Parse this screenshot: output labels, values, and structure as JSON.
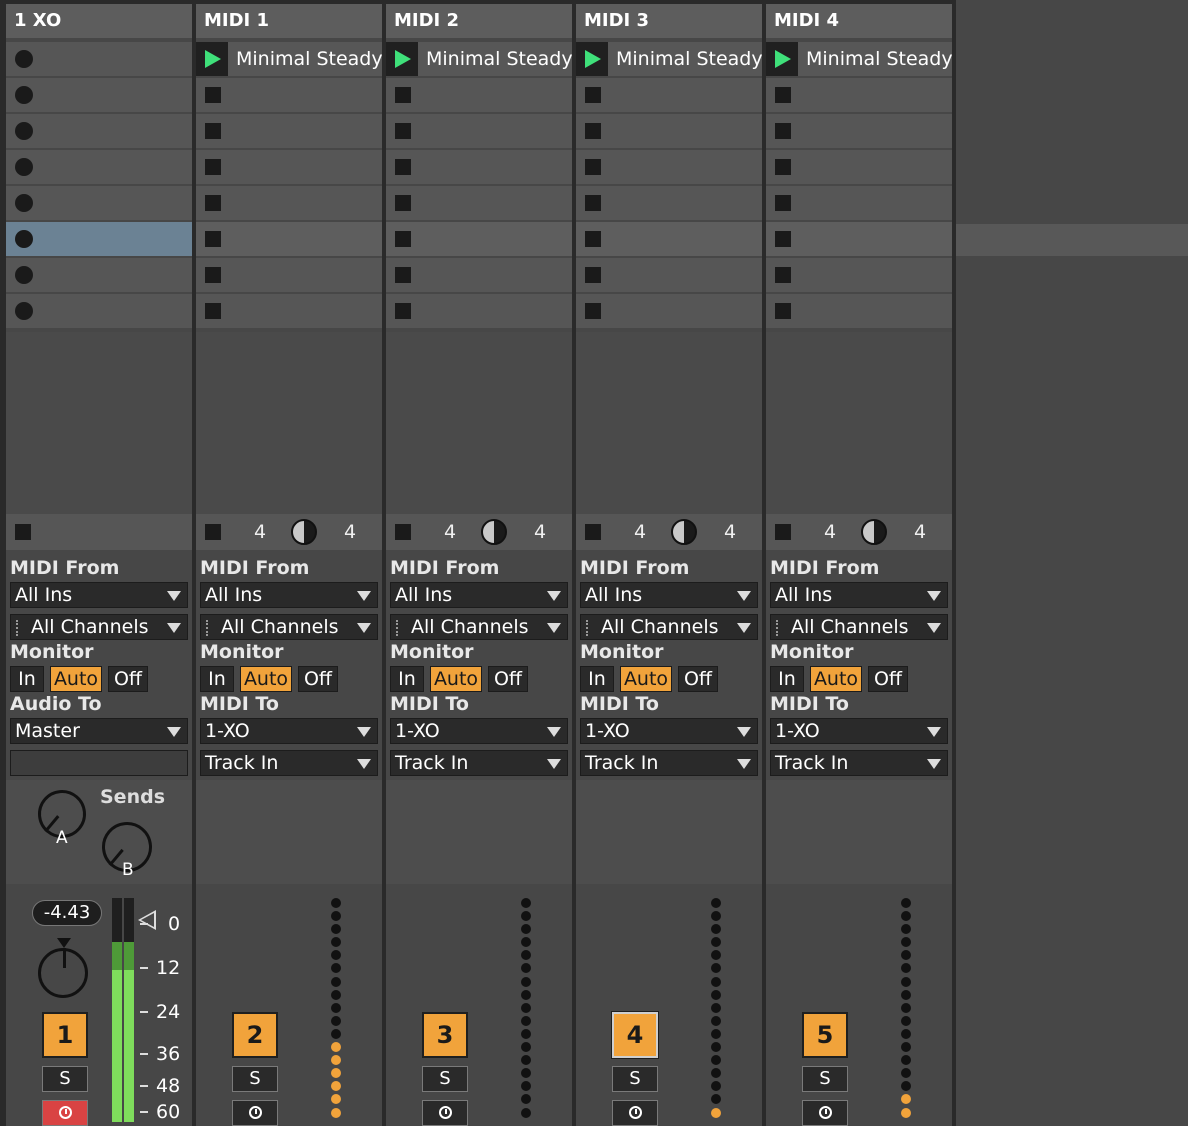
{
  "tracks": [
    {
      "id": "t1",
      "name": "1 XO",
      "kind": "audio",
      "input_label": "MIDI From",
      "input": "All Ins",
      "channel": "All Channels",
      "monitor_label": "Monitor",
      "monitor": [
        "In",
        "Auto",
        "Off"
      ],
      "monitor_active": "Auto",
      "output_label": "Audio To",
      "output": "Master",
      "volume": "-4.43",
      "sends_label": "Sends",
      "send_a": "A",
      "send_b": "B",
      "number": "1",
      "solo": "S",
      "scale": [
        "0",
        "12",
        "24",
        "36",
        "48",
        "60"
      ]
    },
    {
      "id": "t2",
      "name": "MIDI 1",
      "kind": "midi",
      "clip": "Minimal Steady",
      "input_label": "MIDI From",
      "input": "All Ins",
      "channel": "All Channels",
      "monitor_label": "Monitor",
      "monitor": [
        "In",
        "Auto",
        "Off"
      ],
      "monitor_active": "Auto",
      "output_label": "MIDI To",
      "output": "1-XO",
      "output2": "Track In",
      "ts_num": "4",
      "ts_den": "4",
      "number": "2",
      "solo": "S"
    },
    {
      "id": "t3",
      "name": "MIDI 2",
      "kind": "midi",
      "clip": "Minimal Steady",
      "input_label": "MIDI From",
      "input": "All Ins",
      "channel": "All Channels",
      "monitor_label": "Monitor",
      "monitor": [
        "In",
        "Auto",
        "Off"
      ],
      "monitor_active": "Auto",
      "output_label": "MIDI To",
      "output": "1-XO",
      "output2": "Track In",
      "ts_num": "4",
      "ts_den": "4",
      "number": "3",
      "solo": "S"
    },
    {
      "id": "t4",
      "name": "MIDI 3",
      "kind": "midi",
      "clip": "Minimal Steady",
      "input_label": "MIDI From",
      "input": "All Ins",
      "channel": "All Channels",
      "monitor_label": "Monitor",
      "monitor": [
        "In",
        "Auto",
        "Off"
      ],
      "monitor_active": "Auto",
      "output_label": "MIDI To",
      "output": "1-XO",
      "output2": "Track In",
      "ts_num": "4",
      "ts_den": "4",
      "number": "4",
      "solo": "S"
    },
    {
      "id": "t5",
      "name": "MIDI 4",
      "kind": "midi",
      "clip": "Minimal Steady",
      "input_label": "MIDI From",
      "input": "All Ins",
      "channel": "All Channels",
      "monitor_label": "Monitor",
      "monitor": [
        "In",
        "Auto",
        "Off"
      ],
      "monitor_active": "Auto",
      "output_label": "MIDI To",
      "output": "1-XO",
      "output2": "Track In",
      "ts_num": "4",
      "ts_den": "4",
      "number": "5",
      "solo": "S"
    }
  ],
  "colors": {
    "accent": "#f1a33b",
    "play": "#3fe07a",
    "selected_slot": "#6b8294",
    "arm_red": "#d94343"
  },
  "icons": [
    "play-icon",
    "stop-icon",
    "record-slot-icon",
    "knob-icon",
    "meter-icon",
    "arm-clock-icon"
  ]
}
